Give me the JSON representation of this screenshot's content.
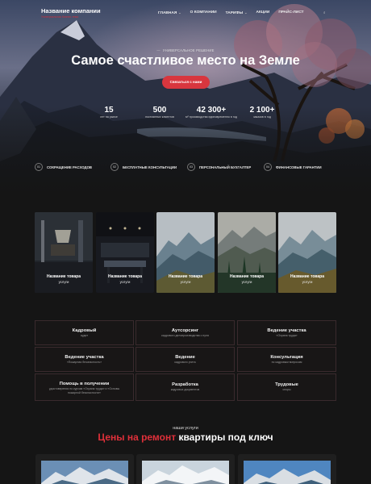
{
  "header": {
    "logo": "Название компании",
    "tagline": "Универсальная бизнес-тема",
    "nav": [
      "ГЛАВНАЯ",
      "О КОМПАНИИ",
      "ТАРИФЫ",
      "АКЦИИ",
      "ПРАЙС-ЛИСТ"
    ],
    "menu_icon": "search-icon"
  },
  "hero": {
    "eyebrow": "УНИВЕРСАЛЬНОЕ РЕШЕНИЕ",
    "title": "Самое счастливое место на Земле",
    "cta": "Связаться с нами",
    "stats": [
      {
        "value": "15",
        "label": "лет на рынке"
      },
      {
        "value": "500",
        "label": "постоянных клиентов"
      },
      {
        "value": "42 300+",
        "label": "м² производства единовременно в год"
      },
      {
        "value": "2 100+",
        "label": "заказов в год"
      }
    ],
    "features": [
      {
        "num": "01",
        "label": "СОКРАЩЕНИЕ РАСХОДОВ"
      },
      {
        "num": "02",
        "label": "БЕСПЛАТНЫЕ КОНСУЛЬТАЦИИ"
      },
      {
        "num": "03",
        "label": "ПЕРСОНАЛЬНЫЙ БУХГАЛТЕР"
      },
      {
        "num": "04",
        "label": "ФИНАНСОВЫЕ ГАРАНТИИ"
      }
    ]
  },
  "products": [
    {
      "title": "Название товара",
      "subtitle": "услуги"
    },
    {
      "title": "Название товара",
      "subtitle": "услуги"
    },
    {
      "title": "Название товара",
      "subtitle": "услуги"
    },
    {
      "title": "Название товара",
      "subtitle": "услуги"
    },
    {
      "title": "Название товара",
      "subtitle": "услуги"
    }
  ],
  "services": [
    {
      "title": "Кадровый",
      "subtitle": "аудит"
    },
    {
      "title": "Аутсорсинг",
      "subtitle": "кадрового делопроизводства с нуля"
    },
    {
      "title": "Ведение участка",
      "subtitle": "«Охрана труда»"
    },
    {
      "title": "Ведение участка",
      "subtitle": "«Пожарная безопасность»"
    },
    {
      "title": "Ведение",
      "subtitle": "кадрового учета"
    },
    {
      "title": "Консультация",
      "subtitle": "по кадровым вопросам"
    },
    {
      "title": "Помощь в получении",
      "subtitle": "удостоверения по курсам «Охрана труда» и «Основы пожарной безопасности»"
    },
    {
      "title": "Разработка",
      "subtitle": "кадровых документов"
    },
    {
      "title": "Трудовые",
      "subtitle": "споры"
    }
  ],
  "prices": {
    "eyebrow": "наши услуги",
    "title_accent": "Цены на ремонт",
    "title_rest": " квартиры под ключ"
  },
  "colors": {
    "accent": "#d8363e",
    "background": "#151515"
  }
}
